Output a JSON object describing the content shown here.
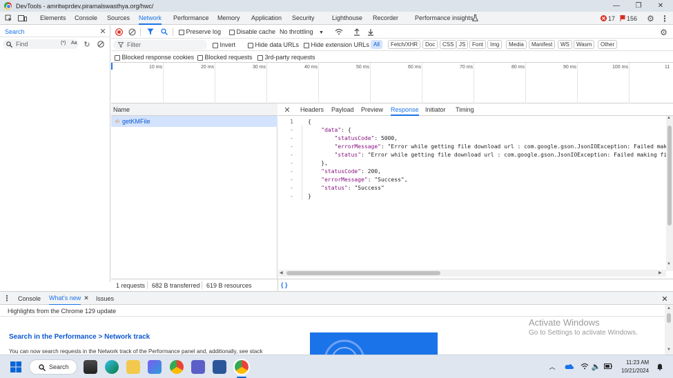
{
  "window": {
    "title": "DevTools - amritwprdev.piramalswasthya.org/hwc/",
    "minimize": "—",
    "maximize": "❐",
    "close": "✕"
  },
  "main_tabs": [
    "Elements",
    "Console",
    "Sources",
    "Network",
    "Performance",
    "Memory",
    "Application",
    "Security",
    "Lighthouse",
    "Recorder",
    "Performance insights"
  ],
  "active_tab": "Network",
  "badges": {
    "errors": "17",
    "warnings": "156"
  },
  "search_panel": {
    "title": "Search",
    "find_placeholder": "Find",
    "regex_label": "(*)",
    "case_label": "Aa"
  },
  "toolbar": {
    "preserve_log": "Preserve log",
    "disable_cache": "Disable cache",
    "throttling": "No throttling"
  },
  "filter": {
    "placeholder": "Filter",
    "invert": "Invert",
    "hide_data_urls": "Hide data URLs",
    "hide_extension_urls": "Hide extension URLs"
  },
  "type_chips": [
    "All",
    "Fetch/XHR",
    "Doc",
    "CSS",
    "JS",
    "Font",
    "Img",
    "Media",
    "Manifest",
    "WS",
    "Wasm",
    "Other"
  ],
  "row3": {
    "blocked_cookies": "Blocked response cookies",
    "blocked_requests": "Blocked requests",
    "third_party": "3rd-party requests"
  },
  "timeline_ticks": [
    "10 ms",
    "20 ms",
    "30 ms",
    "40 ms",
    "50 ms",
    "60 ms",
    "70 ms",
    "80 ms",
    "90 ms",
    "100 ms",
    "11"
  ],
  "request_list": {
    "header": "Name",
    "items": [
      {
        "name": "getKMFile"
      }
    ]
  },
  "detail_tabs": [
    "Headers",
    "Payload",
    "Preview",
    "Response",
    "Initiator",
    "Timing"
  ],
  "active_detail_tab": "Response",
  "response_lines": [
    {
      "gutter": "1",
      "text": "{"
    },
    {
      "gutter": "-",
      "text": "    \"data\": {"
    },
    {
      "gutter": "-",
      "text": "        \"statusCode\": 5000,"
    },
    {
      "gutter": "-",
      "text": "        \"errorMessage\": \"Error while getting file download url : com.google.gson.JsonIOException: Failed makin"
    },
    {
      "gutter": "-",
      "text": "        \"status\": \"Error while getting file download url : com.google.gson.JsonIOException: Failed making fiel"
    },
    {
      "gutter": "-",
      "text": "    },"
    },
    {
      "gutter": "-",
      "text": "    \"statusCode\": 200,"
    },
    {
      "gutter": "-",
      "text": "    \"errorMessage\": \"Success\","
    },
    {
      "gutter": "-",
      "text": "    \"status\": \"Success\""
    },
    {
      "gutter": "-",
      "text": "}"
    }
  ],
  "statusbar": {
    "requests": "1 requests",
    "transferred": "682 B transferred",
    "resources": "619 B resources",
    "pretty": "{ }"
  },
  "drawer": {
    "tabs": [
      "Console",
      "What's new",
      "Issues"
    ],
    "active": "What's new",
    "highlights": "Highlights from the Chrome 129 update",
    "heading": "Search in the Performance > Network track",
    "body": "You can now search requests in the Network track of the Performance panel and, additionally, see stack"
  },
  "watermark": {
    "line1": "Activate Windows",
    "line2": "Go to Settings to activate Windows."
  },
  "taskbar": {
    "search": "Search",
    "time": "11:23 AM",
    "date": "10/21/2024"
  },
  "colors": {
    "accent": "#1a73e8",
    "selected_row": "#d3e3fd",
    "titlebar": "#dde3ea",
    "taskbar": "#dfe6f0"
  }
}
